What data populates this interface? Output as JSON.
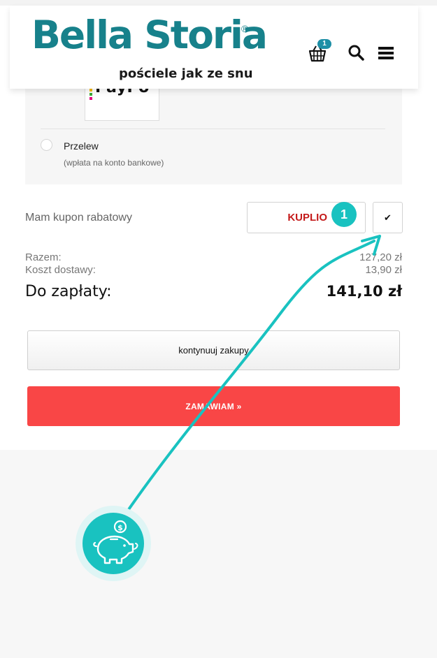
{
  "header": {
    "logo_title": "Bella Storia",
    "logo_registered": "®",
    "logo_tagline": "pościele jak ze snu",
    "cart_count": "1",
    "cart_icon": "basket-icon",
    "search_icon": "search-icon",
    "menu_icon": "hamburger-menu-icon"
  },
  "payment": {
    "payu_logo_text": "PayPo",
    "przelew_label": "Przelew",
    "przelew_note": "(wpłata na konto bankowe)"
  },
  "coupon": {
    "label": "Mam kupon rabatowy",
    "code_value": "KUPLIO",
    "apply_icon": "checkmark-icon",
    "apply_symbol": "✔",
    "step_number": "1"
  },
  "summary": {
    "subtotal_label": "Razem:",
    "subtotal_value": "127,20 zł",
    "shipping_label": "Koszt dostawy:",
    "shipping_value": "13,90 zł",
    "total_label": "Do zapłaty:",
    "total_value": "141,10 zł"
  },
  "actions": {
    "continue_label": "kontynuuj zakupy",
    "order_label": "ZAMAWIAM »"
  },
  "annotation": {
    "badge_icon": "piggy-bank-coin-icon",
    "coin_symbol": "$"
  },
  "colors": {
    "brand_teal": "#17818b",
    "accent_cyan": "#19c2c0",
    "order_red": "#f94646",
    "coupon_red": "#c41a1a"
  }
}
